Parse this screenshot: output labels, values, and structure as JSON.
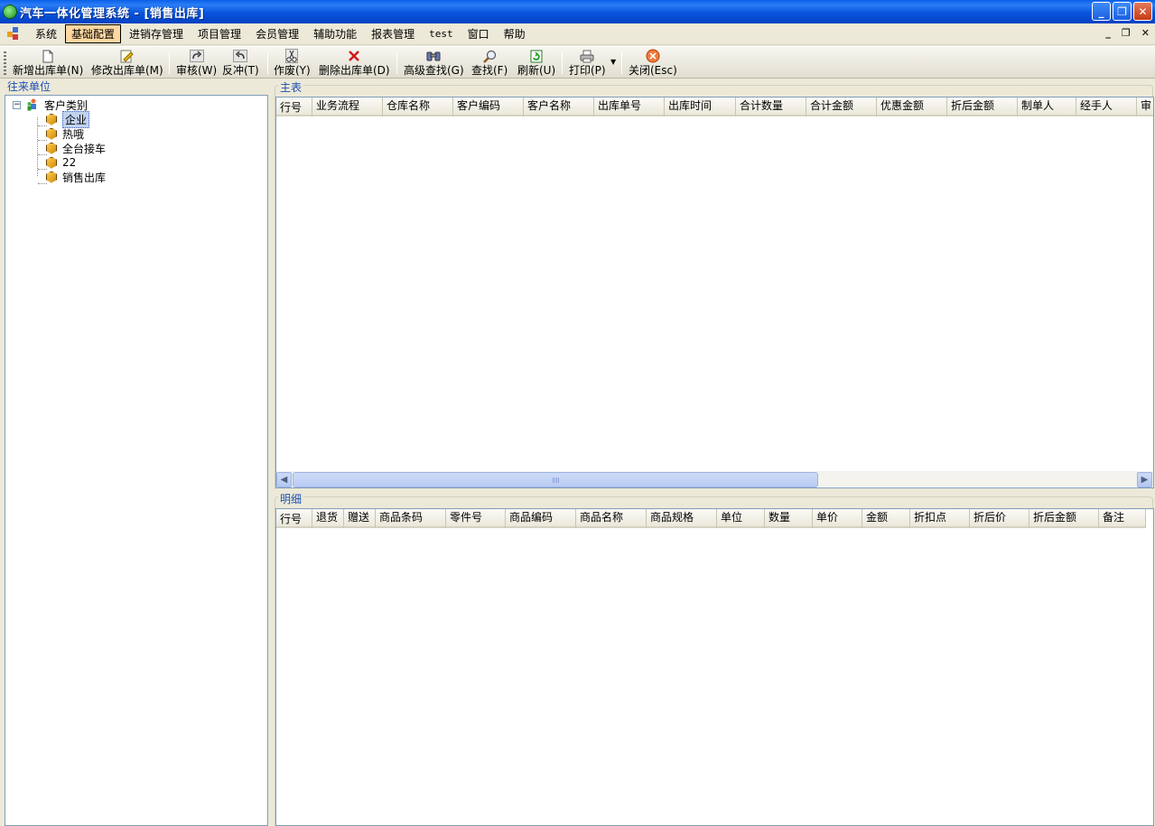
{
  "window": {
    "title": "汽车一体化管理系统 - [销售出库]"
  },
  "menu": {
    "items": [
      "系统",
      "基础配置",
      "进销存管理",
      "项目管理",
      "会员管理",
      "辅助功能",
      "报表管理",
      "test",
      "窗口",
      "帮助"
    ],
    "active": "基础配置"
  },
  "toolbar": {
    "new": "新增出库单(N)",
    "edit": "修改出库单(M)",
    "audit": "审核(W)",
    "reverse": "反冲(T)",
    "void": "作废(Y)",
    "delete": "删除出库单(D)",
    "adv_search": "高级查找(G)",
    "search": "查找(F)",
    "refresh": "刷新(U)",
    "print": "打印(P)",
    "close": "关闭(Esc)"
  },
  "left_panel": {
    "caption": "往来单位",
    "tree": {
      "root": "客户类别",
      "children": [
        "企业",
        "热哦",
        "全台接车",
        "22",
        "销售出库"
      ],
      "selected": "企业"
    }
  },
  "master": {
    "caption": "主表",
    "columns": [
      "行号",
      "业务流程",
      "仓库名称",
      "客户编码",
      "客户名称",
      "出库单号",
      "出库时间",
      "合计数量",
      "合计金额",
      "优惠金额",
      "折后金额",
      "制单人",
      "经手人",
      "审"
    ],
    "rows": []
  },
  "detail": {
    "caption": "明细",
    "columns": [
      "行号",
      "退货",
      "赠送",
      "商品条码",
      "零件号",
      "商品编码",
      "商品名称",
      "商品规格",
      "单位",
      "数量",
      "单价",
      "金额",
      "折扣点",
      "折后价",
      "折后金额",
      "备注"
    ],
    "rows": []
  },
  "colors": {
    "title_bar": "#0855dd",
    "caption_text": "#1d4fb3",
    "menu_active": "#ffd7a0",
    "window_bg": "#ece9d8"
  }
}
